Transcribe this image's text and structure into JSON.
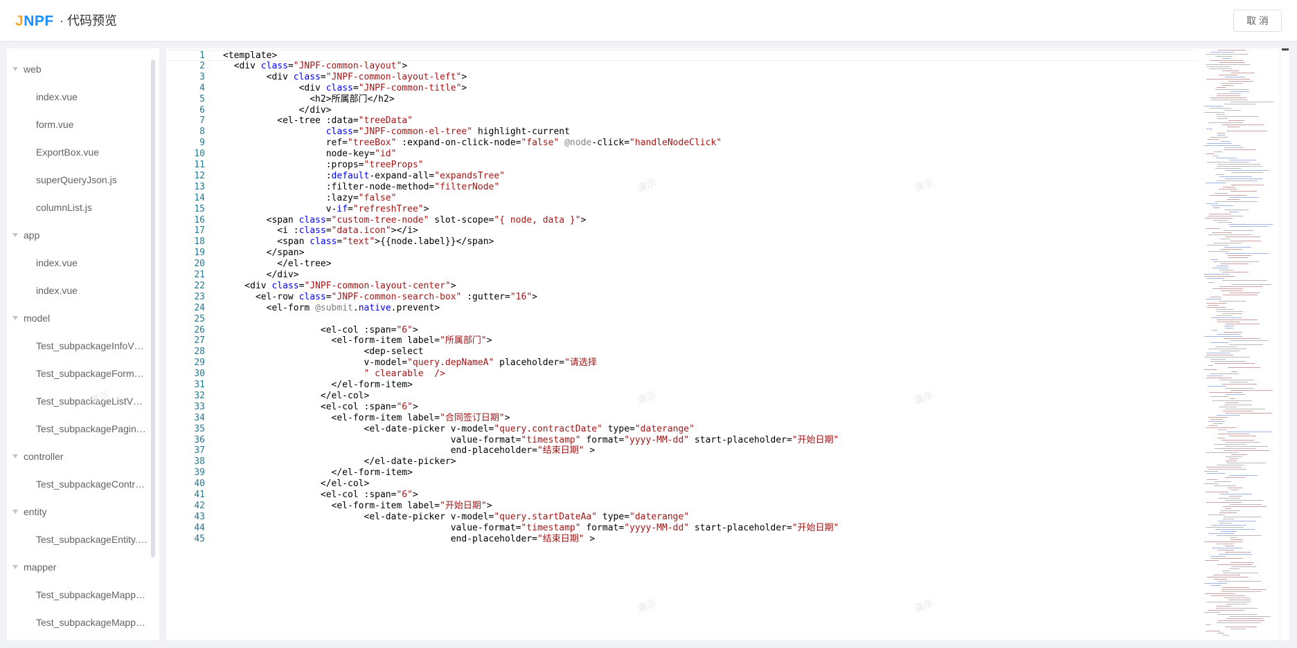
{
  "header": {
    "logo_text": "JNPF",
    "title": "· 代码预览",
    "cancel_label": "取 消"
  },
  "colors": {
    "logo_orange": "#f5a623",
    "logo_blue": "#1890ff",
    "keyword": "#0000ff",
    "string": "#a31515",
    "line_number": "#237893"
  },
  "file_tree": [
    {
      "type": "folder",
      "label": "web"
    },
    {
      "type": "file",
      "label": "index.vue"
    },
    {
      "type": "file",
      "label": "form.vue"
    },
    {
      "type": "file",
      "label": "ExportBox.vue"
    },
    {
      "type": "file",
      "label": "superQueryJson.js"
    },
    {
      "type": "file",
      "label": "columnList.js"
    },
    {
      "type": "folder",
      "label": "app"
    },
    {
      "type": "file",
      "label": "index.vue"
    },
    {
      "type": "file",
      "label": "index.vue"
    },
    {
      "type": "folder",
      "label": "model"
    },
    {
      "type": "file",
      "label": "Test_subpackageInfoV…"
    },
    {
      "type": "file",
      "label": "Test_subpackageForm…"
    },
    {
      "type": "file",
      "label": "Test_subpackageListV…"
    },
    {
      "type": "file",
      "label": "Test_subpackagePagin…"
    },
    {
      "type": "folder",
      "label": "controller"
    },
    {
      "type": "file",
      "label": "Test_subpackageContr…"
    },
    {
      "type": "folder",
      "label": "entity"
    },
    {
      "type": "file",
      "label": "Test_subpackageEntity.…"
    },
    {
      "type": "folder",
      "label": "mapper"
    },
    {
      "type": "file",
      "label": "Test_subpackageMapp…"
    },
    {
      "type": "file",
      "label": "Test_subpackageMapp…"
    }
  ],
  "code_lines": [
    {
      "n": "1",
      "tokens": [
        [
          "t",
          "<template>"
        ]
      ]
    },
    {
      "n": "2",
      "tokens": [
        [
          "t",
          "  <div "
        ],
        [
          "k",
          "class"
        ],
        [
          "t",
          "="
        ],
        [
          "s",
          "\"JNPF-common-layout\""
        ],
        [
          "t",
          ">"
        ]
      ]
    },
    {
      "n": "3",
      "tokens": [
        [
          "t",
          "        <div "
        ],
        [
          "k",
          "class"
        ],
        [
          "t",
          "="
        ],
        [
          "s",
          "\"JNPF-common-layout-left\""
        ],
        [
          "t",
          ">"
        ]
      ]
    },
    {
      "n": "4",
      "tokens": [
        [
          "t",
          "              <div "
        ],
        [
          "k",
          "class"
        ],
        [
          "t",
          "="
        ],
        [
          "s",
          "\"JNPF-common-title\""
        ],
        [
          "t",
          ">"
        ]
      ]
    },
    {
      "n": "5",
      "tokens": [
        [
          "t",
          "                <h2>所属部门</h2>"
        ]
      ]
    },
    {
      "n": "6",
      "tokens": [
        [
          "t",
          "              </div>"
        ]
      ]
    },
    {
      "n": "7",
      "tokens": [
        [
          "t",
          "          <el-tree :data="
        ],
        [
          "s",
          "\"treeData\""
        ]
      ]
    },
    {
      "n": "8",
      "tokens": [
        [
          "t",
          "                   "
        ],
        [
          "k",
          "class"
        ],
        [
          "t",
          "="
        ],
        [
          "s",
          "\"JNPF-common-el-tree\""
        ],
        [
          "t",
          " highlight-current"
        ]
      ]
    },
    {
      "n": "9",
      "tokens": [
        [
          "t",
          "                   ref="
        ],
        [
          "s",
          "\"treeBox\""
        ],
        [
          "t",
          " :expand-on-click-node="
        ],
        [
          "s",
          "\"false\""
        ],
        [
          "t",
          " "
        ],
        [
          "d",
          "@node"
        ],
        [
          "t",
          "-click="
        ],
        [
          "s",
          "\"handleNodeClick\""
        ]
      ]
    },
    {
      "n": "10",
      "tokens": [
        [
          "t",
          "                   node-key="
        ],
        [
          "s",
          "\"id\""
        ]
      ]
    },
    {
      "n": "11",
      "tokens": [
        [
          "t",
          "                   :props="
        ],
        [
          "s",
          "\"treeProps\""
        ]
      ]
    },
    {
      "n": "12",
      "tokens": [
        [
          "t",
          "                   :"
        ],
        [
          "k",
          "default"
        ],
        [
          "t",
          "-expand-all="
        ],
        [
          "s",
          "\"expandsTree\""
        ]
      ]
    },
    {
      "n": "13",
      "tokens": [
        [
          "t",
          "                   :filter-node-method="
        ],
        [
          "s",
          "\"filterNode\""
        ]
      ]
    },
    {
      "n": "14",
      "tokens": [
        [
          "t",
          "                   :lazy="
        ],
        [
          "s",
          "\"false\""
        ]
      ]
    },
    {
      "n": "15",
      "tokens": [
        [
          "t",
          "                   v-"
        ],
        [
          "k",
          "if"
        ],
        [
          "t",
          "="
        ],
        [
          "s",
          "\"refreshTree\""
        ],
        [
          "t",
          ">"
        ]
      ]
    },
    {
      "n": "16",
      "tokens": [
        [
          "t",
          "        <span "
        ],
        [
          "k",
          "class"
        ],
        [
          "t",
          "="
        ],
        [
          "s",
          "\"custom-tree-node\""
        ],
        [
          "t",
          " slot-scope="
        ],
        [
          "s",
          "\"{ node, data }\""
        ],
        [
          "t",
          ">"
        ]
      ]
    },
    {
      "n": "17",
      "tokens": [
        [
          "t",
          "          <i :"
        ],
        [
          "k",
          "class"
        ],
        [
          "t",
          "="
        ],
        [
          "s",
          "\"data.icon\""
        ],
        [
          "t",
          "></i>"
        ]
      ]
    },
    {
      "n": "18",
      "tokens": [
        [
          "t",
          "          <span "
        ],
        [
          "k",
          "class"
        ],
        [
          "t",
          "="
        ],
        [
          "s",
          "\"text\""
        ],
        [
          "t",
          ">{{node.label}}</span>"
        ]
      ]
    },
    {
      "n": "19",
      "tokens": [
        [
          "t",
          "        </span>"
        ]
      ]
    },
    {
      "n": "20",
      "tokens": [
        [
          "t",
          "          </el-tree>"
        ]
      ]
    },
    {
      "n": "21",
      "tokens": [
        [
          "t",
          "        </div>"
        ]
      ]
    },
    {
      "n": "22",
      "tokens": [
        [
          "t",
          "    <div "
        ],
        [
          "k",
          "class"
        ],
        [
          "t",
          "="
        ],
        [
          "s",
          "\"JNPF-common-layout-center\""
        ],
        [
          "t",
          ">"
        ]
      ]
    },
    {
      "n": "23",
      "tokens": [
        [
          "t",
          "      <el-row "
        ],
        [
          "k",
          "class"
        ],
        [
          "t",
          "="
        ],
        [
          "s",
          "\"JNPF-common-search-box\""
        ],
        [
          "t",
          " :gutter="
        ],
        [
          "s",
          "\"16\""
        ],
        [
          "t",
          ">"
        ]
      ]
    },
    {
      "n": "24",
      "tokens": [
        [
          "t",
          "        <el-form "
        ],
        [
          "d",
          "@submit"
        ],
        [
          "t",
          "."
        ],
        [
          "k",
          "native"
        ],
        [
          "t",
          ".prevent>"
        ]
      ]
    },
    {
      "n": "25",
      "tokens": []
    },
    {
      "n": "26",
      "tokens": [
        [
          "t",
          "                  <el-col :span="
        ],
        [
          "s",
          "\"6\""
        ],
        [
          "t",
          ">"
        ]
      ]
    },
    {
      "n": "27",
      "tokens": [
        [
          "t",
          "                    <el-form-item label="
        ],
        [
          "s",
          "\"所属部门\""
        ],
        [
          "t",
          ">"
        ]
      ]
    },
    {
      "n": "28",
      "tokens": [
        [
          "t",
          "                          <dep-select"
        ]
      ]
    },
    {
      "n": "29",
      "tokens": [
        [
          "t",
          "                          v-model="
        ],
        [
          "s",
          "\"query.depNameA\""
        ],
        [
          "t",
          " placeholder="
        ],
        [
          "s",
          "\"请选择"
        ]
      ]
    },
    {
      "n": "30",
      "tokens": [
        [
          "s",
          "                          \" clearable  />"
        ]
      ]
    },
    {
      "n": "31",
      "tokens": [
        [
          "t",
          "                    </el-form-item>"
        ]
      ]
    },
    {
      "n": "32",
      "tokens": [
        [
          "t",
          "                  </el-col>"
        ]
      ]
    },
    {
      "n": "33",
      "tokens": [
        [
          "t",
          "                  <el-col :span="
        ],
        [
          "s",
          "\"6\""
        ],
        [
          "t",
          ">"
        ]
      ]
    },
    {
      "n": "34",
      "tokens": [
        [
          "t",
          "                    <el-form-item label="
        ],
        [
          "s",
          "\"合同签订日期\""
        ],
        [
          "t",
          ">"
        ]
      ]
    },
    {
      "n": "35",
      "tokens": [
        [
          "t",
          "                          <el-date-picker v-model="
        ],
        [
          "s",
          "\"query.contractDate\""
        ],
        [
          "t",
          " type="
        ],
        [
          "s",
          "\"daterange\""
        ]
      ]
    },
    {
      "n": "36",
      "tokens": [
        [
          "t",
          "                                          value-format="
        ],
        [
          "s",
          "\"timestamp\""
        ],
        [
          "t",
          " format="
        ],
        [
          "s",
          "\"yyyy-MM-dd\""
        ],
        [
          "t",
          " start-placeholder="
        ],
        [
          "s",
          "\"开始日期\""
        ]
      ]
    },
    {
      "n": "37",
      "tokens": [
        [
          "t",
          "                                          end-placeholder="
        ],
        [
          "s",
          "\"结束日期\""
        ],
        [
          "t",
          " >"
        ]
      ]
    },
    {
      "n": "38",
      "tokens": [
        [
          "t",
          "                          </el-date-picker>"
        ]
      ]
    },
    {
      "n": "39",
      "tokens": [
        [
          "t",
          "                    </el-form-item>"
        ]
      ]
    },
    {
      "n": "40",
      "tokens": [
        [
          "t",
          "                  </el-col>"
        ]
      ]
    },
    {
      "n": "41",
      "tokens": [
        [
          "t",
          "                  <el-col :span="
        ],
        [
          "s",
          "\"6\""
        ],
        [
          "t",
          ">"
        ]
      ]
    },
    {
      "n": "42",
      "tokens": [
        [
          "t",
          "                    <el-form-item label="
        ],
        [
          "s",
          "\"开始日期\""
        ],
        [
          "t",
          ">"
        ]
      ]
    },
    {
      "n": "43",
      "tokens": [
        [
          "t",
          "                          <el-date-picker v-model="
        ],
        [
          "s",
          "\"query.startDateAa\""
        ],
        [
          "t",
          " type="
        ],
        [
          "s",
          "\"daterange\""
        ]
      ]
    },
    {
      "n": "44",
      "tokens": [
        [
          "t",
          "                                          value-format="
        ],
        [
          "s",
          "\"timestamp\""
        ],
        [
          "t",
          " format="
        ],
        [
          "s",
          "\"yyyy-MM-dd\""
        ],
        [
          "t",
          " start-placeholder="
        ],
        [
          "s",
          "\"开始日期\""
        ]
      ]
    },
    {
      "n": "45",
      "tokens": [
        [
          "t",
          "                                          end-placeholder="
        ],
        [
          "s",
          "\"结束日期\""
        ],
        [
          "t",
          " >"
        ]
      ]
    }
  ],
  "watermark_text": "演示"
}
